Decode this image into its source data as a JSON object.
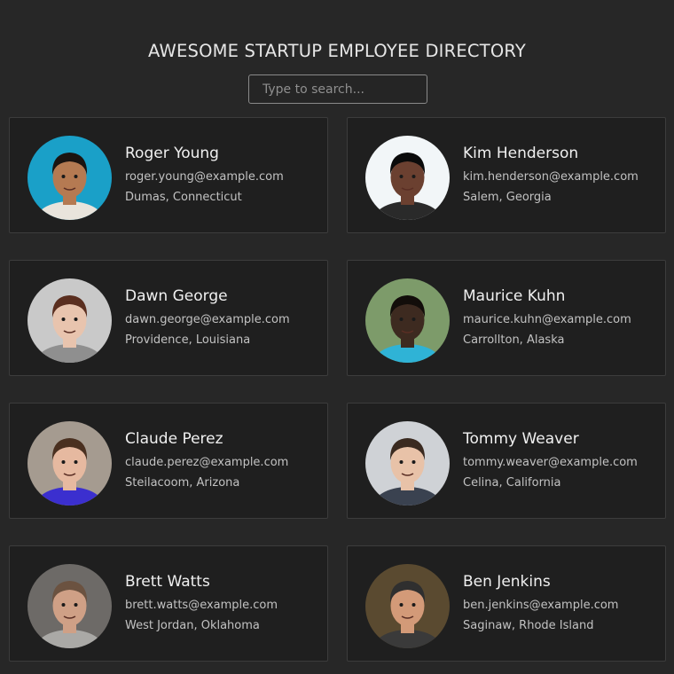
{
  "header": {
    "title": "AWESOME STARTUP EMPLOYEE DIRECTORY",
    "search_placeholder": "Type to search..."
  },
  "employees": [
    {
      "name": "Roger Young",
      "email": "roger.young@example.com",
      "location": "Dumas, Connecticut",
      "avatar_bg": "#1aa0c8",
      "skin": "#b57a52",
      "hair": "#1b1411",
      "shirt": "#e9e4dc"
    },
    {
      "name": "Kim Henderson",
      "email": "kim.henderson@example.com",
      "location": "Salem, Georgia",
      "avatar_bg": "#f2f6f8",
      "skin": "#6b4030",
      "hair": "#0b0b0b",
      "shirt": "#2a2a2a"
    },
    {
      "name": "Dawn George",
      "email": "dawn.george@example.com",
      "location": "Providence, Louisiana",
      "avatar_bg": "#c9c9c9",
      "skin": "#e8c4ae",
      "hair": "#5a2e1f",
      "shirt": "#8f8f8f"
    },
    {
      "name": "Maurice Kuhn",
      "email": "maurice.kuhn@example.com",
      "location": "Carrollton, Alaska",
      "avatar_bg": "#7d9b6a",
      "skin": "#3d2a20",
      "hair": "#120d0a",
      "shirt": "#2fb3d6"
    },
    {
      "name": "Claude Perez",
      "email": "claude.perez@example.com",
      "location": "Steilacoom, Arizona",
      "avatar_bg": "#a59b90",
      "skin": "#e6b9a0",
      "hair": "#4a3020",
      "shirt": "#3b2fcf"
    },
    {
      "name": "Tommy Weaver",
      "email": "tommy.weaver@example.com",
      "location": "Celina, California",
      "avatar_bg": "#cfd2d6",
      "skin": "#e8c2a8",
      "hair": "#3a2a20",
      "shirt": "#3a4250"
    },
    {
      "name": "Brett Watts",
      "email": "brett.watts@example.com",
      "location": "West Jordan, Oklahoma",
      "avatar_bg": "#6d6a67",
      "skin": "#cfa086",
      "hair": "#6b5240",
      "shirt": "#aaa9a6"
    },
    {
      "name": "Ben Jenkins",
      "email": "ben.jenkins@example.com",
      "location": "Saginaw, Rhode Island",
      "avatar_bg": "#5a4a30",
      "skin": "#d39a78",
      "hair": "#2f2f2f",
      "shirt": "#3a3a3a"
    }
  ]
}
